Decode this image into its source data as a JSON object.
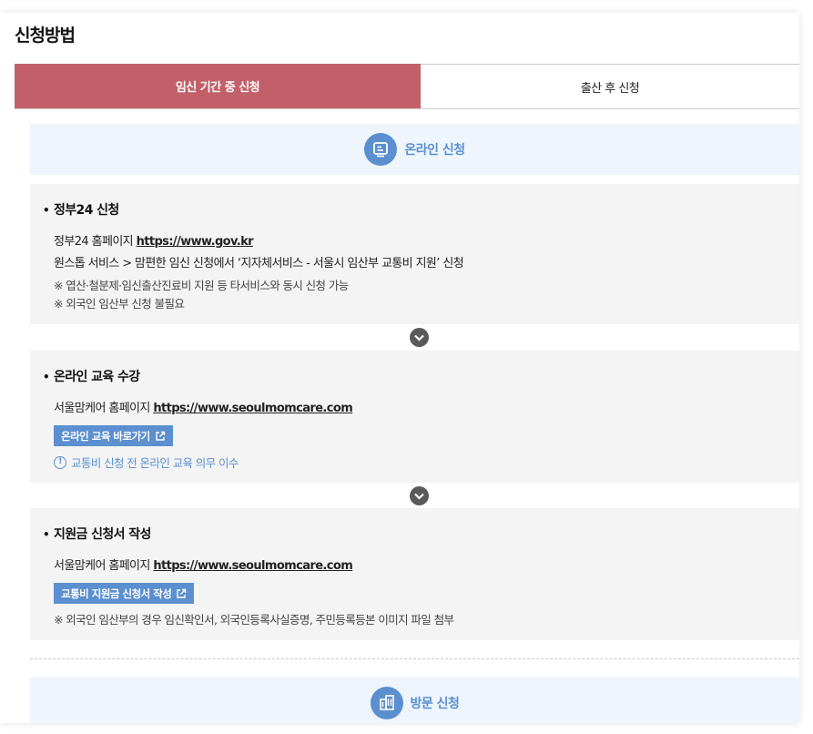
{
  "page_title": "신청방법",
  "tabs": [
    {
      "label": "임신 기간 중 신청",
      "active": true
    },
    {
      "label": "출산 후 신청",
      "active": false
    }
  ],
  "online": {
    "label": "온라인 신청",
    "icon": "document-icon"
  },
  "steps": {
    "gov24": {
      "title": "정부24 신청",
      "homepage_label": "정부24 홈페이지",
      "homepage_url": "https://www.gov.kr",
      "path": "원스톱 서비스 > 맘편한 임신 신청에서 ‘지자체서비스 - 서울시 임산부 교통비 지원’ 신청",
      "notes": [
        "※ 엽산·철분제·임신출산진료비 지원 등 타서비스와 동시 신청 가능",
        "※ 외국인 임산부 신청 불필요"
      ]
    },
    "education": {
      "title": "온라인 교육 수강",
      "homepage_label": "서울맘케어 홈페이지",
      "homepage_url": "https://www.seoulmomcare.com",
      "button_label": "온라인 교육 바로가기",
      "info": "교통비 신청 전 온라인 교육 의무 이수"
    },
    "application": {
      "title": "지원금 신청서 작성",
      "homepage_label": "서울맘케어 홈페이지",
      "homepage_url": "https://www.seoulmomcare.com",
      "button_label": "교통비 지원금 신청서 작성",
      "note": "※ 외국인 임산부의 경우 임신확인서, 외국인등록사실증명, 주민등록등본 이미지 파일 첨부"
    }
  },
  "visit": {
    "label": "방문 신청",
    "icon": "building-icon"
  },
  "colors": {
    "active_tab": "#c2606a",
    "accent_blue": "#5b8fcf",
    "method_bg": "#eef5fd",
    "box_bg": "#f4f4f4"
  }
}
